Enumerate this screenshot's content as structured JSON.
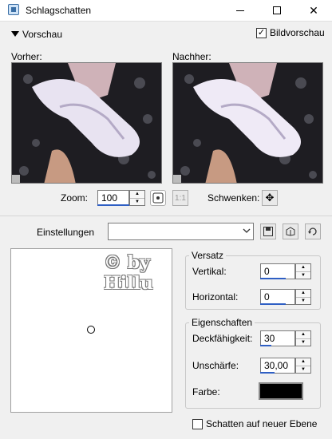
{
  "window": {
    "title": "Schlagschatten",
    "close_glyph": "✕"
  },
  "preview": {
    "toggle_label": "Vorschau",
    "show_preview_label": "Bildvorschau",
    "show_preview_checked": true,
    "before_label": "Vorher:",
    "after_label": "Nachher:"
  },
  "zoom": {
    "label": "Zoom:",
    "value": "100"
  },
  "pan": {
    "label": "Schwenken:"
  },
  "settings": {
    "label": "Einstellungen",
    "value": ""
  },
  "watermark": {
    "line1": "© by",
    "line2": "Hillu"
  },
  "offset": {
    "group_title": "Versatz",
    "vertical_label": "Vertikal:",
    "vertical_value": "0",
    "horizontal_label": "Horizontal:",
    "horizontal_value": "0"
  },
  "properties": {
    "group_title": "Eigenschaften",
    "opacity_label": "Deckfähigkeit:",
    "opacity_value": "30",
    "blur_label": "Unschärfe:",
    "blur_value": "30,00",
    "color_label": "Farbe:",
    "color_value": "#000000"
  },
  "new_layer": {
    "label": "Schatten auf neuer Ebene",
    "checked": false
  },
  "colors": {
    "title_bg": "#ffffff",
    "dialog_bg": "#f0f0f0",
    "accent": "#2f5fc4"
  },
  "icons": [
    "app-icon",
    "minimize-icon",
    "maximize-icon",
    "close-icon",
    "collapse-triangle-icon",
    "checkbox-icon",
    "spin-arrows-icon",
    "zoom-fit-icon",
    "actual-size-icon",
    "move-pan-icon",
    "dropdown-chevron-icon",
    "save-preset-icon",
    "load-preset-icon",
    "reset-icon"
  ]
}
